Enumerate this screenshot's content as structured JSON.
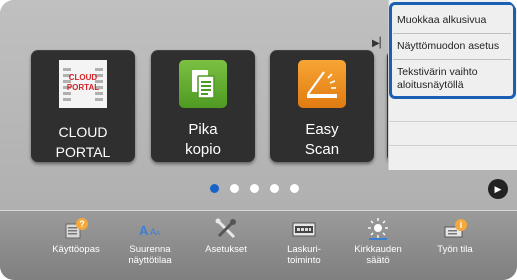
{
  "tiles": [
    {
      "label": "CLOUD PORTAL",
      "icon": "cloud-portal-icon",
      "icon_text": "CLOUD\nPORTAL"
    },
    {
      "label": "Pika\nkopio",
      "icon": "copy-icon"
    },
    {
      "label": "Easy\nScan",
      "icon": "scan-icon"
    }
  ],
  "drawer_menu": {
    "items": [
      "Muokkaa alkusivua",
      "Näyttömuodon asetus",
      "Tekstivärin vaihto aloitusnäytöllä"
    ]
  },
  "pagination": {
    "pages": 5,
    "current": 1
  },
  "bottom_bar": {
    "items": [
      {
        "label": "Käyttöopas",
        "icon": "manual-icon"
      },
      {
        "label": "Suurenna\nnäyttötilaa",
        "icon": "enlarge-display-icon"
      },
      {
        "label": "Asetukset",
        "icon": "settings-tools-icon"
      },
      {
        "label": "Laskuri-\ntoiminto",
        "icon": "counter-icon"
      },
      {
        "label": "Kirkkauden\nsäätö",
        "icon": "brightness-icon"
      },
      {
        "label": "Työn tila",
        "icon": "job-status-icon"
      }
    ]
  },
  "colors": {
    "highlight": "#1b5fb3",
    "active_dot": "#1a63c6",
    "copy_tile": "#5fa82e",
    "scan_tile": "#f09320",
    "cloud_red": "#d4262b"
  }
}
